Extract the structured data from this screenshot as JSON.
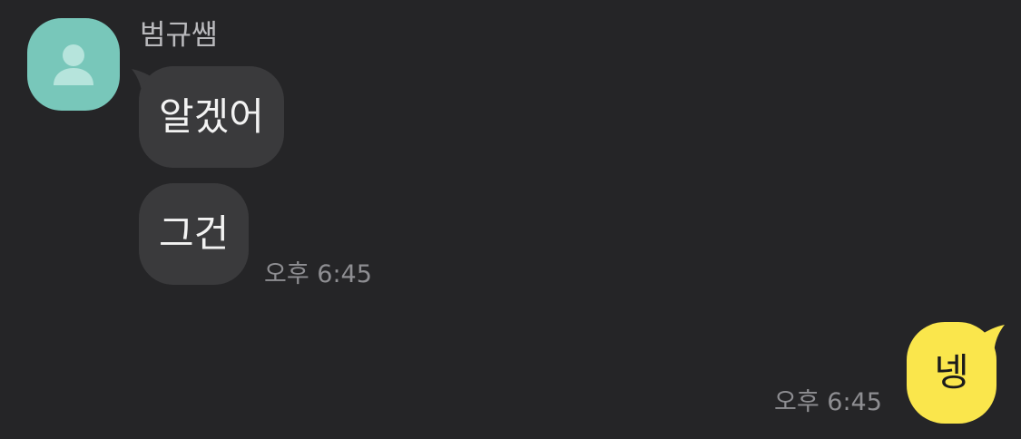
{
  "conversation": {
    "sender": {
      "name": "범규쌤",
      "avatar_icon": "person-icon",
      "avatar_color": "#78c7ba"
    },
    "incoming": [
      {
        "text": "알겠어"
      },
      {
        "text": "그건"
      }
    ],
    "incoming_time": "오후 6:45",
    "outgoing": [
      {
        "text": "넹"
      }
    ],
    "outgoing_time": "오후 6:45",
    "colors": {
      "background": "#252527",
      "incoming_bubble": "#3a3a3c",
      "outgoing_bubble": "#fae64c"
    }
  }
}
